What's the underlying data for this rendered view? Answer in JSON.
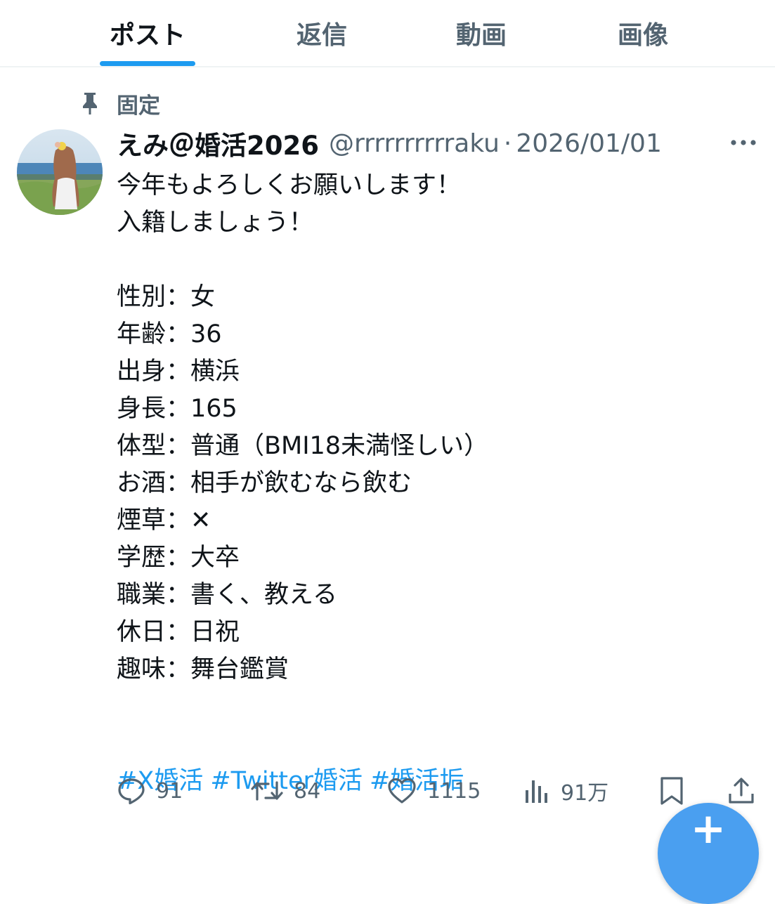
{
  "tabs": [
    {
      "label": "ポスト",
      "active": true
    },
    {
      "label": "返信",
      "active": false
    },
    {
      "label": "動画",
      "active": false
    },
    {
      "label": "画像",
      "active": false
    }
  ],
  "pinned": {
    "label": "固定",
    "icon": "pin-icon"
  },
  "post": {
    "display_name": "えみ＠婚活2026",
    "handle": "@rrrrrrrrrraku",
    "separator": "·",
    "date": "2026/01/01",
    "body_lines": [
      "今年もよろしくお願いします！",
      "入籍しましょう！",
      "",
      "性別：女",
      "年齢：36",
      "出身：横浜",
      "身長：165",
      "体型：普通（BMI18未満怪しい）",
      "お酒：相手が飲むなら飲む",
      "煙草：✕",
      "学歴：大卒",
      "職業：書く、教える",
      "休日：日祝",
      "趣味：舞台鑑賞",
      ""
    ],
    "hashtags": [
      "#X婚活",
      "#Twitter婚活",
      "#婚活垢"
    ]
  },
  "actions": {
    "reply": {
      "icon": "reply-icon",
      "count": "91"
    },
    "repost": {
      "icon": "repost-icon",
      "count": "84"
    },
    "like": {
      "icon": "heart-icon",
      "count": "1115"
    },
    "views": {
      "icon": "views-icon",
      "count": "91万"
    },
    "bookmark": {
      "icon": "bookmark-icon"
    },
    "share": {
      "icon": "share-icon"
    }
  },
  "fab": {
    "icon": "compose-plus-icon",
    "label": "+"
  },
  "colors": {
    "accent": "#1d9bf0",
    "text": "#0f1419",
    "muted": "#536471",
    "divider": "#eff3f4"
  }
}
